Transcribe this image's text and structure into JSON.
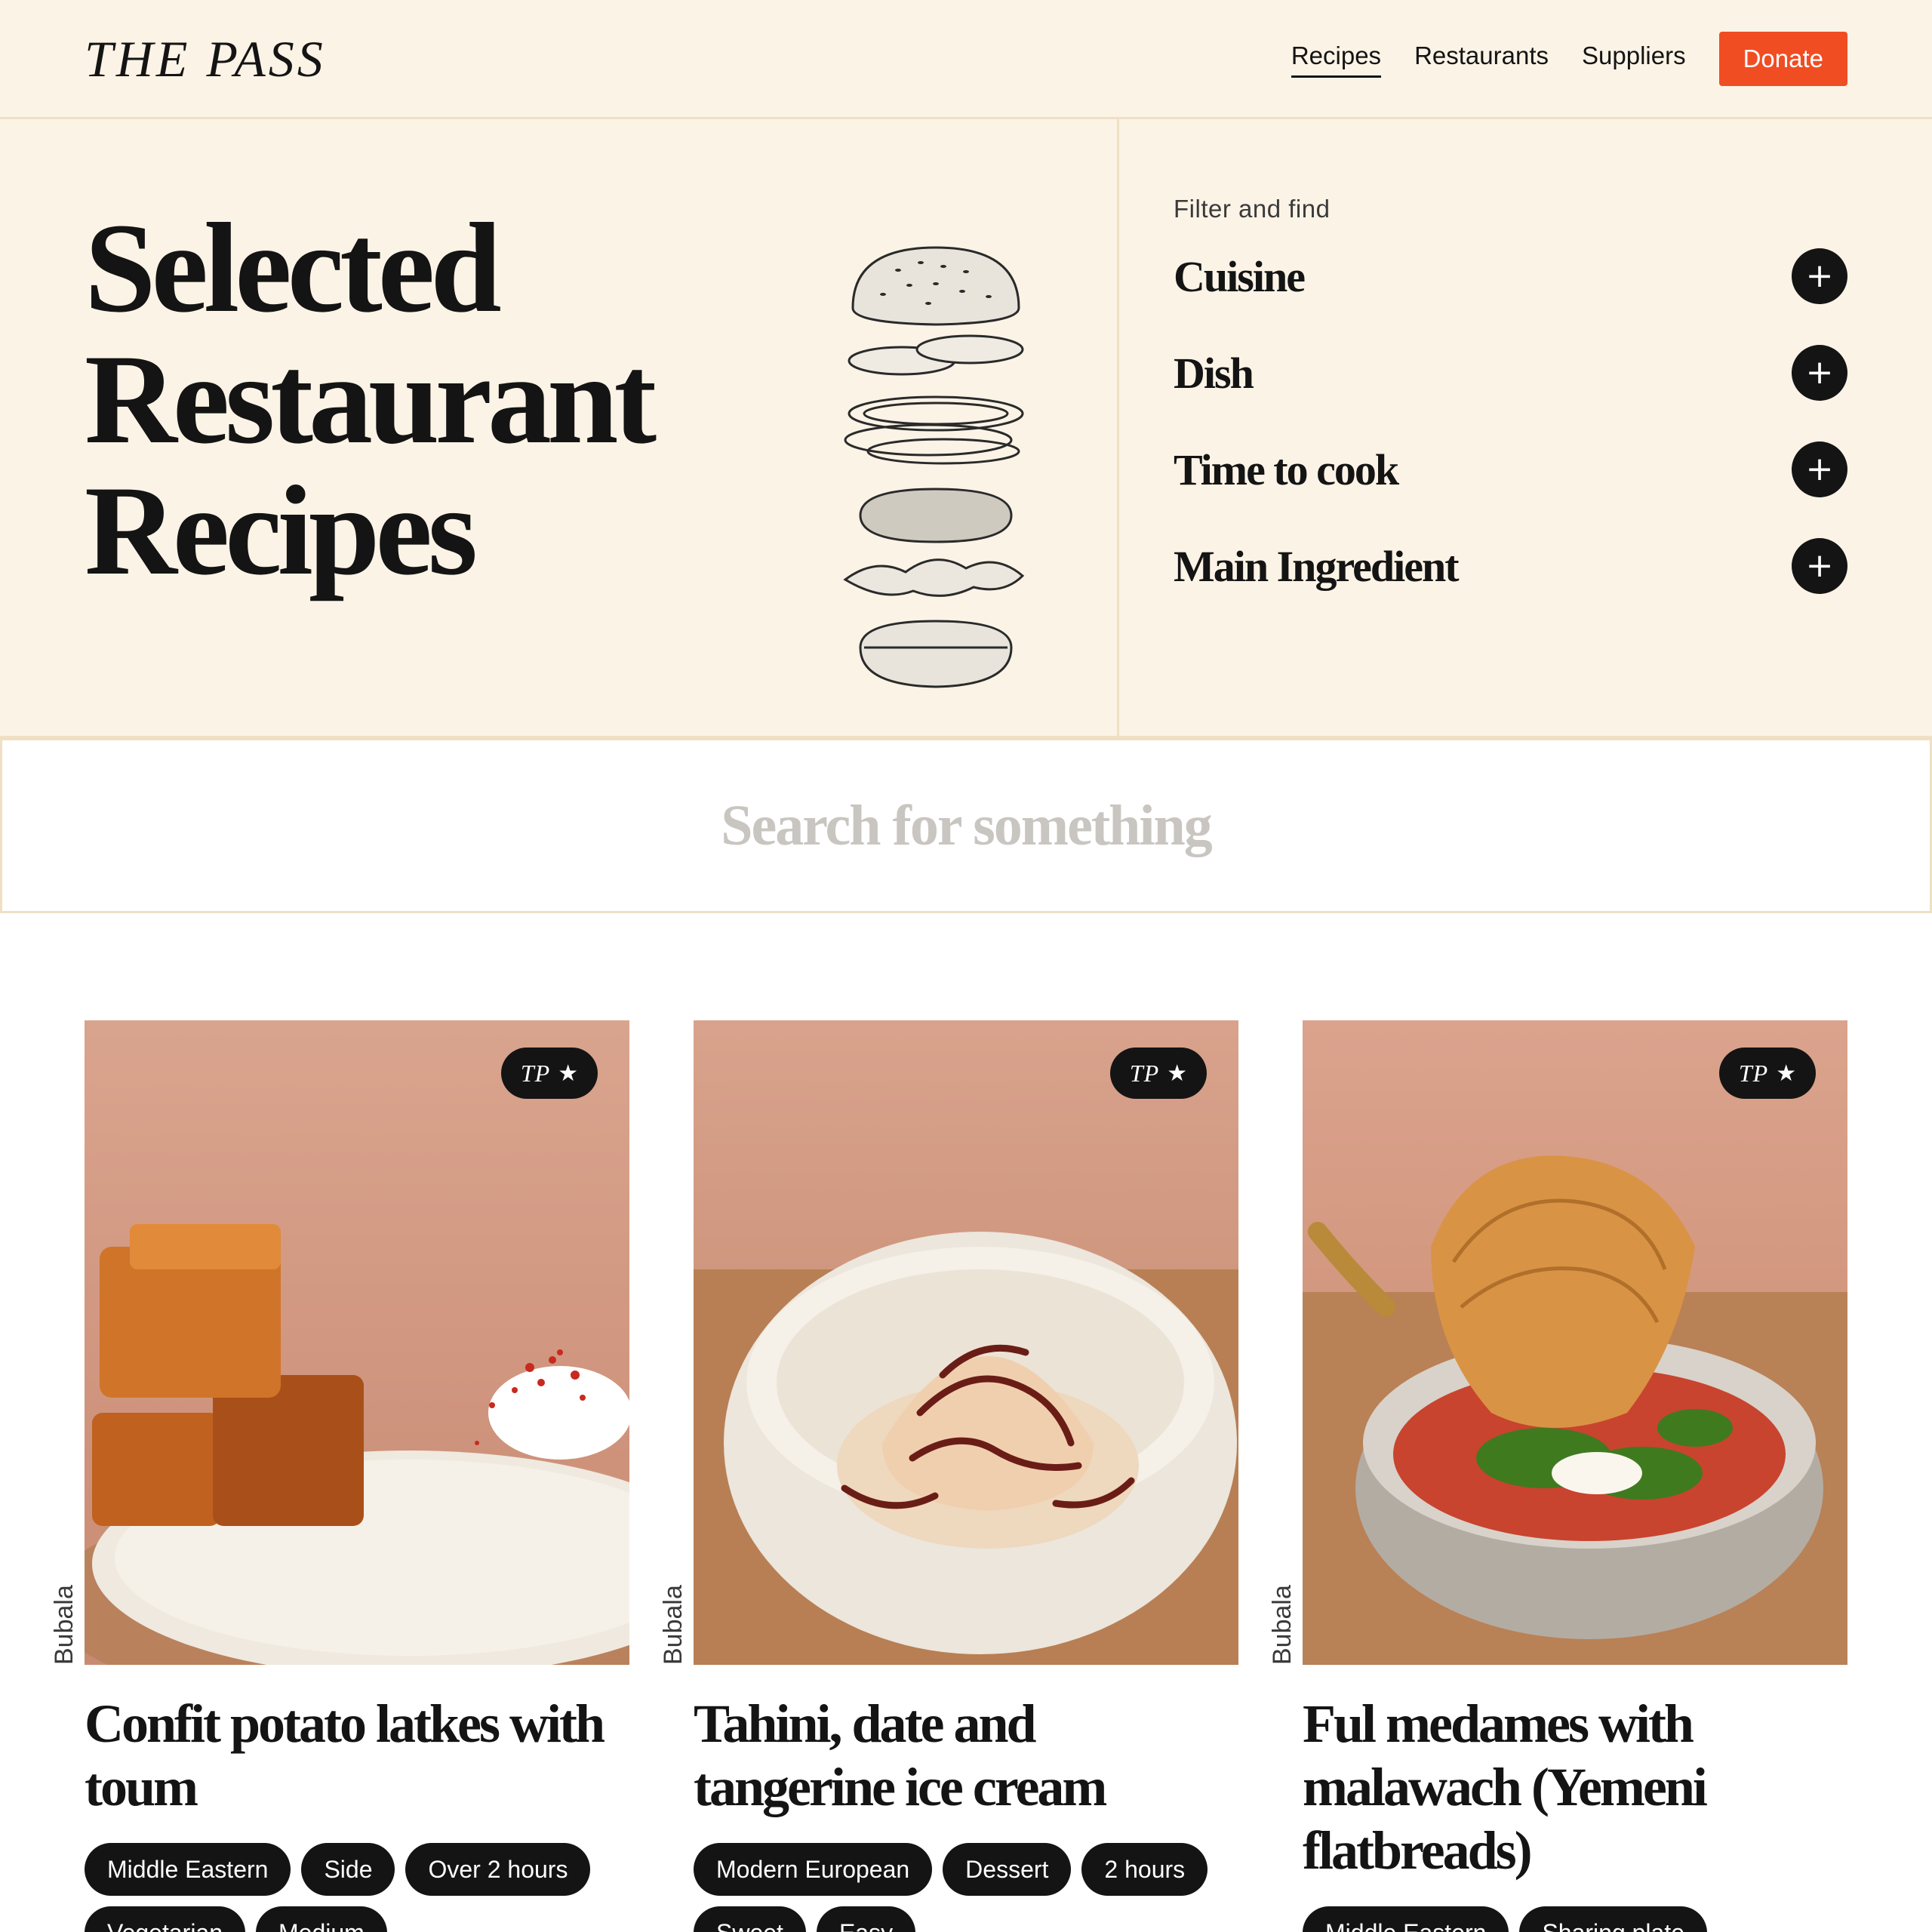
{
  "header": {
    "logo": "THE PASS",
    "nav": [
      {
        "label": "Recipes",
        "active": true
      },
      {
        "label": "Restaurants",
        "active": false
      },
      {
        "label": "Suppliers",
        "active": false
      }
    ],
    "donate_label": "Donate"
  },
  "hero": {
    "title_lines": [
      "Selected",
      "Restaurant",
      "Recipes"
    ],
    "filter_label": "Filter and find",
    "filters": [
      {
        "name": "Cuisine",
        "icon": "plus-icon"
      },
      {
        "name": "Dish",
        "icon": "plus-icon"
      },
      {
        "name": "Time to cook",
        "icon": "plus-icon"
      },
      {
        "name": "Main Ingredient",
        "icon": "plus-icon"
      }
    ]
  },
  "search": {
    "placeholder": "Search for something",
    "value": ""
  },
  "recipes": [
    {
      "badge": "TP",
      "badge_icon": "star-icon",
      "restaurant": "Bubala",
      "title": "Confit potato latkes with toum",
      "tags": [
        "Middle Eastern",
        "Side",
        "Over 2 hours",
        "Vegetarian",
        "Medium"
      ]
    },
    {
      "badge": "TP",
      "badge_icon": "star-icon",
      "restaurant": "Bubala",
      "title": "Tahini, date and tangerine ice cream",
      "tags": [
        "Modern European",
        "Dessert",
        "2 hours",
        "Sweet",
        "Easy"
      ]
    },
    {
      "badge": "TP",
      "badge_icon": "star-icon",
      "restaurant": "Bubala",
      "title": "Ful medames with malawach (Yemeni flatbreads)",
      "tags": [
        "Middle Eastern",
        "Sharing plate"
      ]
    }
  ],
  "colors": {
    "cream": "#fbf3e6",
    "border": "#efe0c4",
    "ink": "#141414",
    "accent": "#f04d23"
  }
}
